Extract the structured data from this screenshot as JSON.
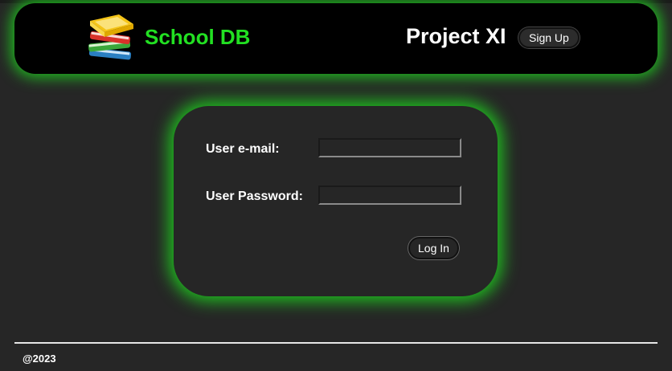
{
  "header": {
    "app_title": "School DB",
    "project_title": "Project XI",
    "signup_label": "Sign Up",
    "logo_icon": "books-icon"
  },
  "login": {
    "email_label": "User e-mail:",
    "email_value": "",
    "password_label": "User Password:",
    "password_value": "",
    "login_label": "Log In"
  },
  "footer": {
    "copyright": "@2023"
  },
  "colors": {
    "accent_green": "#22e022",
    "glow_green": "#1fc21f",
    "background": "#262626",
    "header_background": "#000000"
  }
}
